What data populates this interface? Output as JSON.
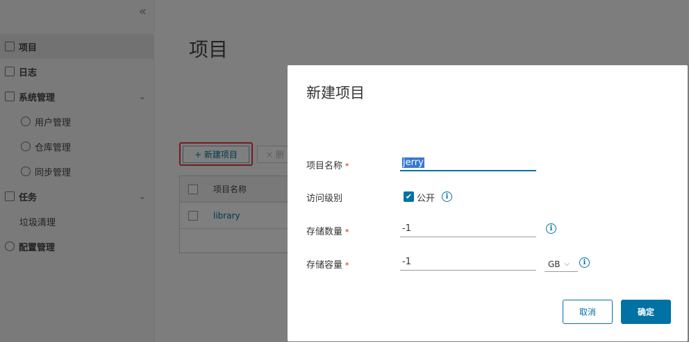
{
  "sidebar": {
    "collapse_icon": "double-chevron-left-icon",
    "items": [
      {
        "label": "项目"
      },
      {
        "label": "日志"
      },
      {
        "label": "系统管理"
      },
      {
        "label": "用户管理"
      },
      {
        "label": "仓库管理"
      },
      {
        "label": "同步管理"
      },
      {
        "label": "任务"
      },
      {
        "label": "垃圾清理"
      },
      {
        "label": "配置管理"
      }
    ]
  },
  "main": {
    "title": "项目",
    "new_project_label": "+ 新建项目",
    "delete_label": "× 删",
    "grid": {
      "header": "项目名称",
      "rows": [
        "library"
      ]
    }
  },
  "modal": {
    "title": "新建项目",
    "fields": {
      "name_label": "项目名称",
      "name_value": "jerry",
      "access_label": "访问级别",
      "public_label": "公开",
      "count_label": "存储数量",
      "count_value": "-1",
      "capacity_label": "存储容量",
      "capacity_value": "-1",
      "capacity_unit": "GB"
    },
    "required_mark": "*",
    "cancel_label": "取消",
    "ok_label": "确定"
  },
  "colors": {
    "primary": "#0072a3",
    "highlight": "#e53935",
    "required": "#c92100"
  }
}
